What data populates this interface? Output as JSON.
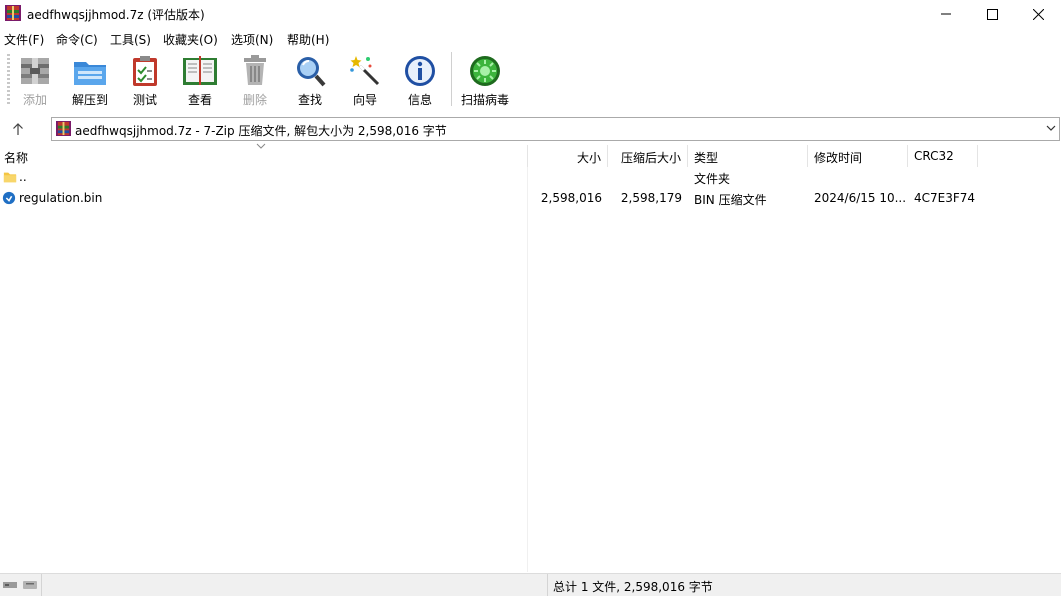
{
  "window": {
    "title": "aedfhwqsjjhmod.7z (评估版本)"
  },
  "menu": [
    "文件(F)",
    "命令(C)",
    "工具(S)",
    "收藏夹(O)",
    "选项(N)",
    "帮助(H)"
  ],
  "toolbar": {
    "buttons": [
      {
        "label": "添加",
        "icon": "add-archive-icon",
        "enabled": false
      },
      {
        "label": "解压到",
        "icon": "extract-folder-icon",
        "enabled": true
      },
      {
        "label": "测试",
        "icon": "test-clipboard-icon",
        "enabled": true
      },
      {
        "label": "查看",
        "icon": "view-book-icon",
        "enabled": true
      },
      {
        "label": "删除",
        "icon": "trash-icon",
        "enabled": false
      },
      {
        "label": "查找",
        "icon": "magnifier-icon",
        "enabled": true
      },
      {
        "label": "向导",
        "icon": "wizard-wand-icon",
        "enabled": true
      },
      {
        "label": "信息",
        "icon": "info-icon",
        "enabled": true
      },
      {
        "label": "扫描病毒",
        "icon": "virus-scan-icon",
        "enabled": true
      }
    ]
  },
  "address": {
    "text": "aedfhwqsjjhmod.7z - 7-Zip 压缩文件, 解包大小为 2,598,016 字节"
  },
  "columns": {
    "name": "名称",
    "size": "大小",
    "packed": "压缩后大小",
    "type": "类型",
    "modified": "修改时间",
    "crc": "CRC32"
  },
  "rows": [
    {
      "name": "..",
      "size": "",
      "packed": "",
      "type": "文件夹",
      "modified": "",
      "crc": "",
      "icon": "folder-icon"
    },
    {
      "name": "regulation.bin",
      "size": "2,598,016",
      "packed": "2,598,179",
      "type": "BIN 压缩文件",
      "modified": "2024/6/15 10...",
      "crc": "4C7E3F74",
      "icon": "bin-file-icon"
    }
  ],
  "status": {
    "summary": "总计 1 文件, 2,598,016 字节"
  },
  "colors": {
    "winrar_red": "#b02020",
    "folder_yellow": "#f4c542",
    "header_separator": "#e4e4e4"
  }
}
